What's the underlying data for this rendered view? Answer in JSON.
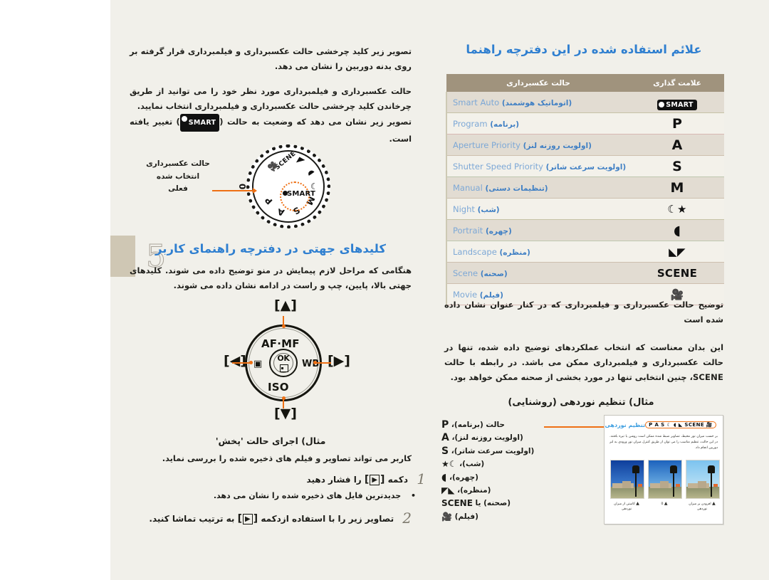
{
  "page": {
    "number": "5"
  },
  "right_column": {
    "title": "علائم استفاده شده در این دفترچه راهنما",
    "table": {
      "header_mode": "حالت عکسبرداری",
      "header_symbol": "علامت گذاری",
      "rows": [
        {
          "symbol": "SMART",
          "symbol_kind": "smart-badge",
          "mode_en": "Smart Auto",
          "mode_fa": "(اتوماتیک هوشمند)"
        },
        {
          "symbol": "P",
          "symbol_kind": "text",
          "mode_en": "Program",
          "mode_fa": "(برنامه)"
        },
        {
          "symbol": "A",
          "symbol_kind": "text",
          "mode_en": "Aperture Priority",
          "mode_fa": "(اولویت روزنه لنز)"
        },
        {
          "symbol": "S",
          "symbol_kind": "text",
          "mode_en": "Shutter Speed Priority",
          "mode_fa": "(اولویت سرعت شاتر)"
        },
        {
          "symbol": "M",
          "symbol_kind": "text",
          "mode_en": "Manual",
          "mode_fa": "(تنظیمات دستی)"
        },
        {
          "symbol": "☾★",
          "symbol_kind": "text",
          "mode_en": "Night",
          "mode_fa": "(شب)"
        },
        {
          "symbol": "◖",
          "symbol_kind": "text",
          "mode_en": "Portrait",
          "mode_fa": "(چهره)"
        },
        {
          "symbol": "◣◤",
          "symbol_kind": "text",
          "mode_en": "Landscape",
          "mode_fa": "(منظره)"
        },
        {
          "symbol": "SCENE",
          "symbol_kind": "text-small",
          "mode_en": "Scene",
          "mode_fa": "(صحنه)"
        },
        {
          "symbol": "🎥",
          "symbol_kind": "text",
          "mode_en": "Movie",
          "mode_fa": "(فیلم)"
        }
      ]
    },
    "desc_1": "توضیح حالت عکسبرداری و فیلمبرداری که در کنار عنوان نشان داده شده است",
    "desc_2_a": "این بدان معناست که انتخاب عملکردهای توضیح داده شده، تنها در حالت عکسبرداری و فیلمبرداری ممکن می باشد. در رابطه با حالت ",
    "desc_2_scene": "SCENE",
    "desc_2_b": "، چنین انتخابی تنها در مورد بخشی از صحنه ممکن خواهد بود.",
    "example": {
      "title": "مثال) تنظیم نوردهی (روشنایی)",
      "mode_list": [
        {
          "sym": "P",
          "fa": "حالت (برنامه)،"
        },
        {
          "sym": "A",
          "fa": "(اولویت روزنه لنز)،"
        },
        {
          "sym": "S",
          "fa": "(اولویت سرعت شاتر)،"
        },
        {
          "sym": "☾★",
          "fa": "(شب)،"
        },
        {
          "sym": "◖",
          "fa": "(چهره)،"
        },
        {
          "sym": "◣◤",
          "fa": "(منظره)،"
        },
        {
          "sym": "SCENE",
          "fa": "(صحنه) یا"
        },
        {
          "sym": "🎥",
          "fa": "(فیلم)"
        }
      ],
      "panel": {
        "heading": "تنظیم نوردهی (روشنایی)",
        "chip": "P A S ☾ ◖ ◣ SCENE 🎥",
        "body": "بر حسب میزان نور محیط، تصاویر ضبط شده ممکن است روشن یا تیره بافتند. در این حالت، تنظیم مناسب را می توان از طریق کنترل میزان نور ورودی به لنز دوربین انجام داد.",
        "thumbs": [
          {
            "caption": "افزودن بر میزان نوردهی",
            "marker": "▲"
          },
          {
            "caption": "0",
            "marker": "▲"
          },
          {
            "caption": "کاستن از میزان نوردهی",
            "marker": "▲"
          }
        ]
      }
    }
  },
  "left_column": {
    "para_1": "تصویر زیر کلید چرخشی حالت عکسبرداری و فیلمبرداری قرار گرفته بر روی بدنه دوربین را نشان می دهد.",
    "para_2": "حالت عکسبرداری و فیلمبرداری مورد نظر خود را می توانید از طریق چرخاندن کلید چرخشی حالت عکسبرداری و فیلمبرداری انتخاب نمایید.",
    "para_3_a": "تصویر زیر نشان می دهد که وضعیت به حالت (",
    "para_3_badge": "SMART",
    "para_3_b": ") تغییر یافته است.",
    "dial": {
      "caption": "حالت عکسبرداری انتخاب شده فعلی",
      "center_label": "SMART",
      "labels": [
        "SCENE",
        "P",
        "A",
        "S",
        "M"
      ]
    },
    "heading": "کلیدهای جهتی در دفترچه راهنمای کاربر",
    "para_4": "هنگامی که مراحل لازم پیمایش در منو توضیح داده می شوند. کلیدهای جهتی بالا، پایین، چپ و راست در ادامه نشان داده می شوند.",
    "dpad": {
      "up": "[▲]",
      "down": "[▼]",
      "left": "[◀]",
      "right": "[▶]",
      "label_top": "AF·MF",
      "label_bottom": "ISO",
      "label_right": "WB",
      "label_ok": "OK"
    },
    "example2": {
      "title": "مثال) اجرای حالت 'پخش'",
      "subtitle": "کاربر می تواند تصاویر و فیلم های ذخیره شده را بررسی نماید.",
      "step_1_num": "1",
      "step_1_a": "دکمه",
      "step_1_key": "▶",
      "step_1_b": "را فشار دهید",
      "step_1_bullet": "•",
      "step_1_note": "جدیدترین فایل های ذخیره شده را نشان می دهد.",
      "step_2_num": "2",
      "step_2_a": "تصاویر زیر را با استفاده ازدکمه",
      "step_2_key": "▶",
      "step_2_b": "به ترتیب تماشا کنید."
    }
  },
  "colors": {
    "page_bg": "#f1f0ea",
    "table_header": "#a0937d",
    "row_alt": "#e2dcd2",
    "accent_orange": "#ee7014",
    "accent_blue": "#2f7fd0",
    "mode_blue": "#7da8d6",
    "tab_tan": "#cfc7b4"
  }
}
